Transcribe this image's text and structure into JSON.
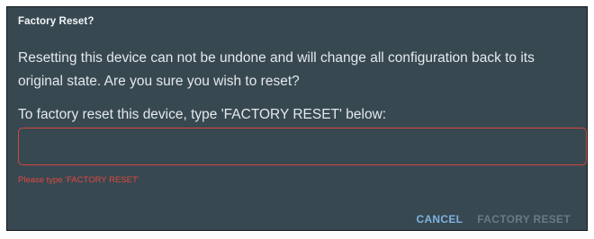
{
  "dialog": {
    "title": "Factory Reset?",
    "message": "Resetting this device can not be undone and will change all configuration back to its original state. Are you sure you wish to reset?",
    "prompt": "To factory reset this device, type 'FACTORY RESET' below:",
    "input": {
      "value": "",
      "placeholder": ""
    },
    "error": "Please type 'FACTORY RESET'",
    "buttons": {
      "cancel": "CANCEL",
      "confirm": "FACTORY RESET"
    }
  },
  "colors": {
    "background": "#374851",
    "error": "#e0483f",
    "accent": "#7fb2e0",
    "disabled": "#6b7a82"
  }
}
